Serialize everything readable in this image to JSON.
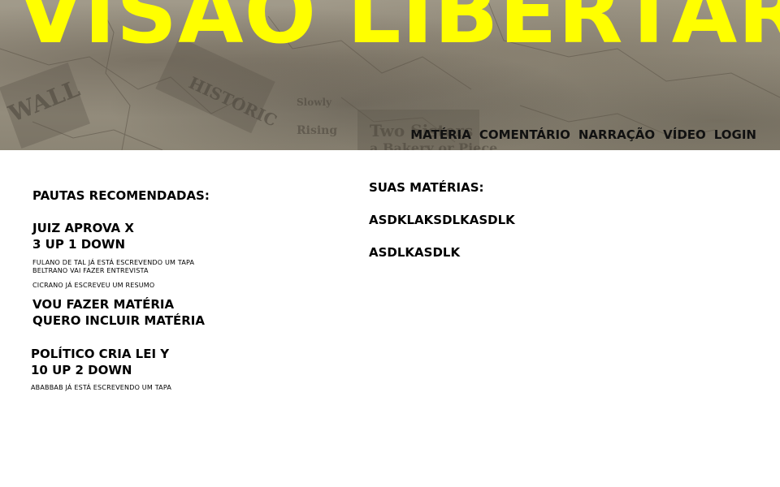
{
  "header": {
    "site_title": "VISÃO LIBERTÁRIA",
    "nav": [
      "MATÉRIA",
      "COMENTÁRIO",
      "NARRAÇÃO",
      "VÍDEO",
      "LOGIN"
    ]
  },
  "recommended": {
    "heading": "PAUTAS RECOMENDADAS:",
    "pautas": [
      {
        "title": "JUIZ APROVA X",
        "votes": "3 UP 1 DOWN",
        "notes_group1": [
          "FULANO DE TAL JÁ ESTÁ ESCREVENDO UM TAPA",
          "BELTRANO VAI FAZER ENTREVISTA"
        ],
        "notes_group2": [
          "CICRANO JÁ ESCREVEU UM RESUMO"
        ]
      },
      {
        "title": "POLÍTICO CRIA LEI Y",
        "votes": "10 UP 2 DOWN",
        "notes_group1": [
          "ABABBAB JÁ ESTÁ ESCREVENDO UM TAPA"
        ]
      }
    ],
    "actions": [
      "VOU FAZER MATÉRIA",
      "QUERO INCLUIR MATÉRIA"
    ]
  },
  "my_stories": {
    "heading": "SUAS MATÉRIAS:",
    "items": [
      "ASDKLAKSDLKASDLK",
      "ASDLKASDLK"
    ]
  },
  "colors": {
    "title": "#ffff00",
    "nav_text": "#111111",
    "header_bg": "#9a9383",
    "page_bg": "#ffffff"
  }
}
